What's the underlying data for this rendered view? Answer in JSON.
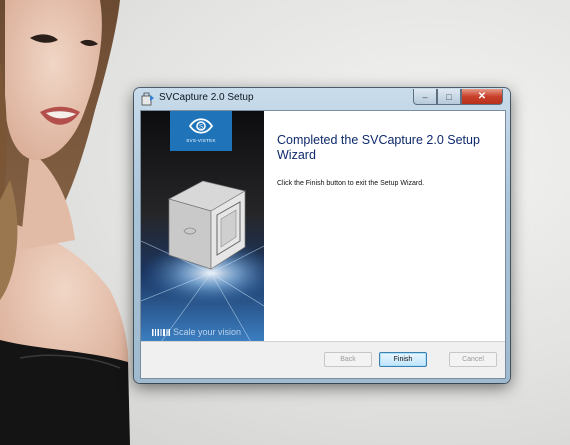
{
  "window": {
    "title": "SVCapture 2.0 Setup",
    "controls": {
      "minimize": "–",
      "maximize": "□",
      "close": "✕"
    }
  },
  "banner": {
    "logo_text": "SVS-VISTEK",
    "slogan": "Scale your vision"
  },
  "wizard": {
    "heading": "Completed the SVCapture 2.0 Setup Wizard",
    "description": "Click the Finish button to exit the Setup Wizard."
  },
  "buttons": {
    "back": "Back",
    "finish": "Finish",
    "cancel": "Cancel"
  },
  "colors": {
    "heading": "#0f2a6b",
    "brand_blue": "#1e73b9",
    "close_button": "#c9402a"
  }
}
